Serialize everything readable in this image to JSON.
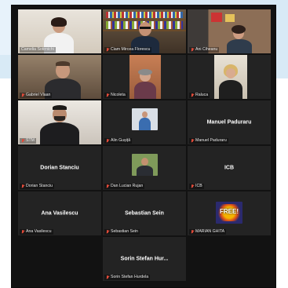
{
  "participants": [
    {
      "name": "Camelia Sotirnichi",
      "type": "video"
    },
    {
      "name": "Ciam Mircea Florescu",
      "type": "video"
    },
    {
      "name": "Ani Ciheanu",
      "type": "video"
    },
    {
      "name": "Gabriel Vlaan",
      "type": "video"
    },
    {
      "name": "Nicoleta",
      "type": "video"
    },
    {
      "name": "Raluca",
      "type": "video"
    },
    {
      "name": "STM",
      "type": "video"
    },
    {
      "name": "Alin Gușiță",
      "type": "avatar"
    },
    {
      "name": "Manuel Paduraru",
      "type": "name",
      "display": "Manuel Paduraru"
    },
    {
      "name": "Dorian Stanciu",
      "type": "name",
      "display": "Dorian Stanciu"
    },
    {
      "name": "Dan Lucian Rujan",
      "type": "avatar"
    },
    {
      "name": "ICB",
      "type": "name",
      "display": "ICB"
    },
    {
      "name": "Ana Vasilescu",
      "type": "name",
      "display": "Ana Vasilescu"
    },
    {
      "name": "Sebastian Sein",
      "type": "name",
      "display": "Sebastian Sein"
    },
    {
      "name": "MARIAN GHITA",
      "type": "avatar",
      "avatar_text": "FREE!"
    },
    {
      "name": "Sorin Stefan Hurdela",
      "type": "name",
      "display": "Sorin Stefan Hur..."
    }
  ],
  "colors": {
    "muted_mic": "#e14b3a",
    "tile_bg": "#232323",
    "frame_bg": "#121212"
  }
}
